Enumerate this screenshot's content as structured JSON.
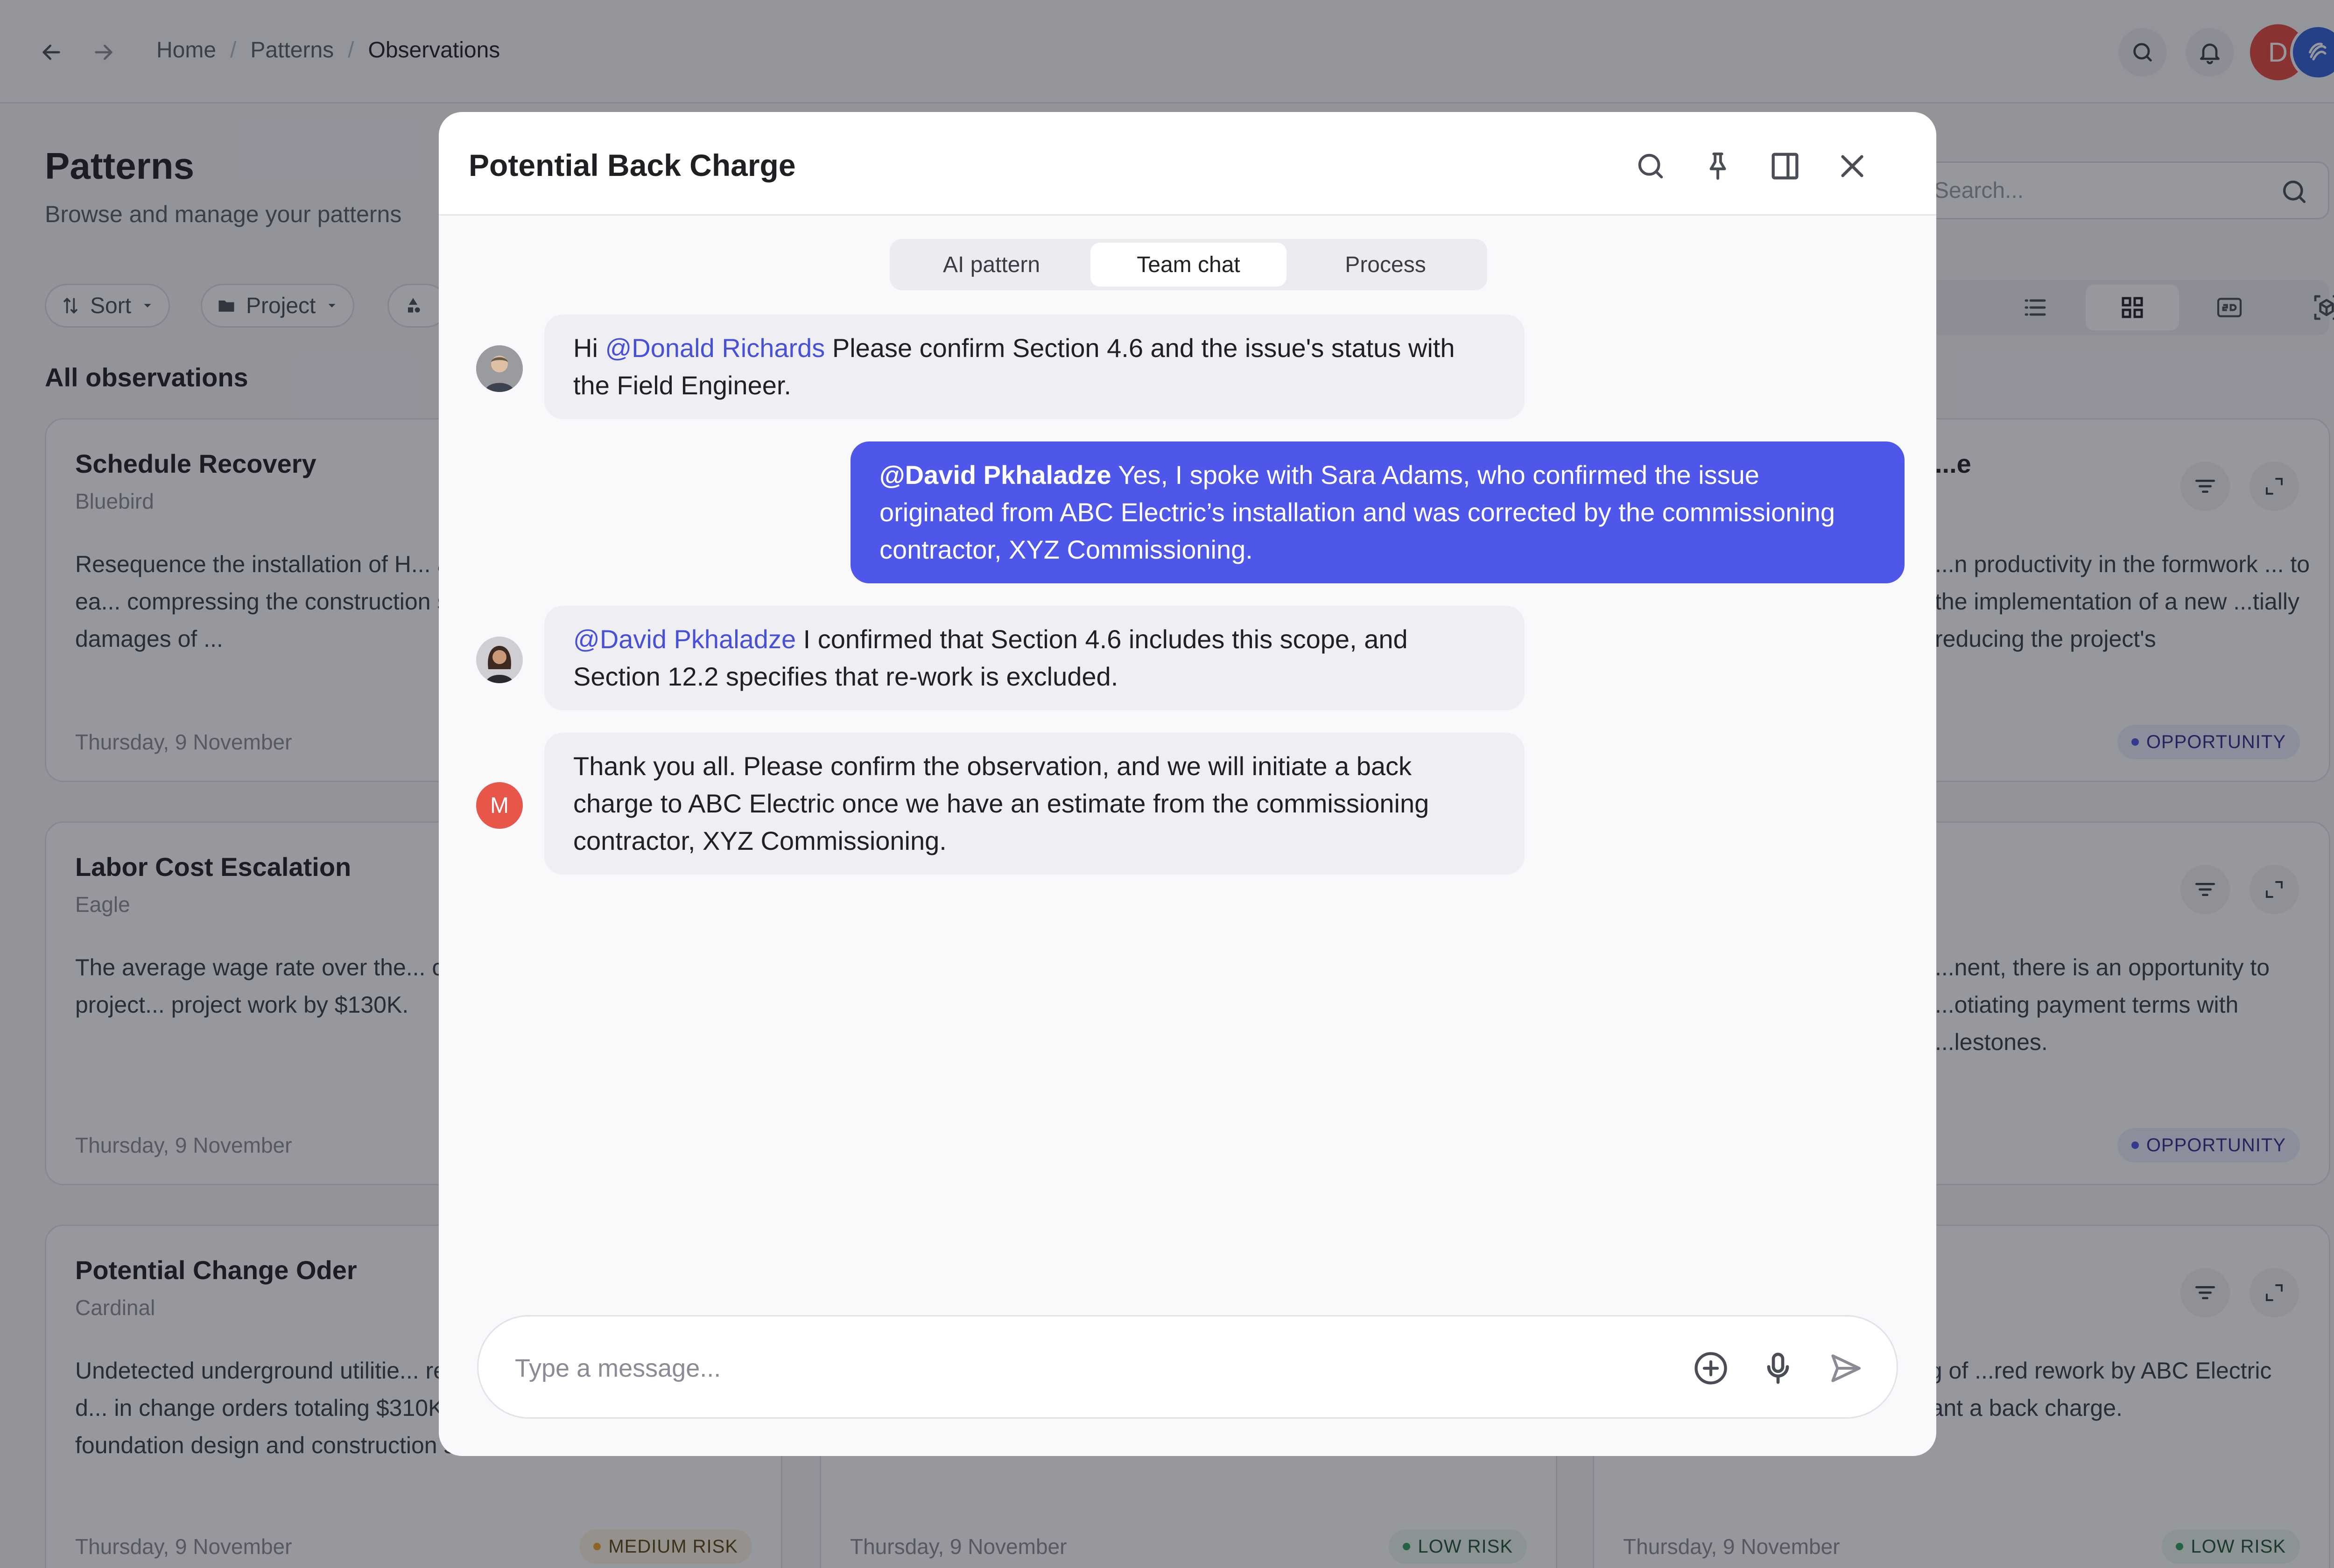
{
  "breadcrumb": [
    "Home",
    "Patterns",
    "Observations"
  ],
  "user_initial": "D",
  "page": {
    "title": "Patterns",
    "subtitle": "Browse and manage your patterns",
    "filters": [
      "Sort",
      "Project"
    ],
    "section_title": "All observations",
    "search_placeholder": "Search..."
  },
  "cards": [
    {
      "title": "Schedule Recovery",
      "project": "Bluebird",
      "body": "Resequence the installation of H... advantage of an unexpected ea... compressing the construction s... avoiding liquidated damages of ...",
      "date": "Thursday, 9 November"
    },
    {
      "title": "...e",
      "project": "",
      "body": "...n productivity in the formwork ... to the implementation of a new ...tially reducing the project's",
      "date": "",
      "badge": "OPPORTUNITY"
    },
    {
      "title": "Labor Cost Escalation",
      "project": "Eagle",
      "body": "The average wage rate over the... cost increases on similar project... project work by $130K.",
      "date": "Thursday, 9 November"
    },
    {
      "title": "",
      "project": "",
      "body": "...nent, there is an opportunity to ...otiating payment terms with ...lestones.",
      "date": "",
      "badge": "OPPORTUNITY"
    },
    {
      "title": "Potential Change Oder",
      "project": "Cardinal",
      "body": "Undetected underground utilitie... report, may require re-routing d... in change orders totaling $310K ... adjustment of the foundation design and construction se...",
      "date": "Thursday, 9 November",
      "badge": "MEDIUM RISK"
    },
    {
      "title": "",
      "project": "",
      "body": "",
      "date": "Thursday, 9 November",
      "badge": "LOW RISK"
    },
    {
      "title": "",
      "project": "",
      "body": "...ed during pre-commissioning of ...red rework by ABC Electric and, ...actual terms, may warrant a back charge.",
      "date": "Thursday, 9 November",
      "badge": "LOW RISK"
    }
  ],
  "modal": {
    "title": "Potential Back Charge",
    "tabs": [
      "AI pattern",
      "Team chat",
      "Process"
    ],
    "active_tab": "Team chat",
    "messages": [
      {
        "mention": "@Donald Richards",
        "prefix": "Hi ",
        "text": " Please confirm Section 4.6 and the issue's status with the Field Engineer."
      },
      {
        "mention": "@David Pkhaladze",
        "text": " Yes, I spoke with Sara Adams, who confirmed the issue originated from ABC Electric’s installation and was corrected by the commissioning contractor, XYZ Commissioning."
      },
      {
        "mention": "@David Pkhaladze",
        "text": " I confirmed that Section 4.6 includes this scope, and Section 12.2 specifies that re-work is excluded."
      },
      {
        "avatar_initial": "M",
        "text": "Thank you all. Please confirm the observation, and we will initiate a back charge to ABC Electric once we have an estimate from the commissioning contractor, XYZ Commissioning."
      }
    ],
    "composer_placeholder": "Type a message..."
  },
  "colors": {
    "accent": "#4f56ea",
    "mention": "#4650d9",
    "avatar_m": "#e8564a"
  }
}
